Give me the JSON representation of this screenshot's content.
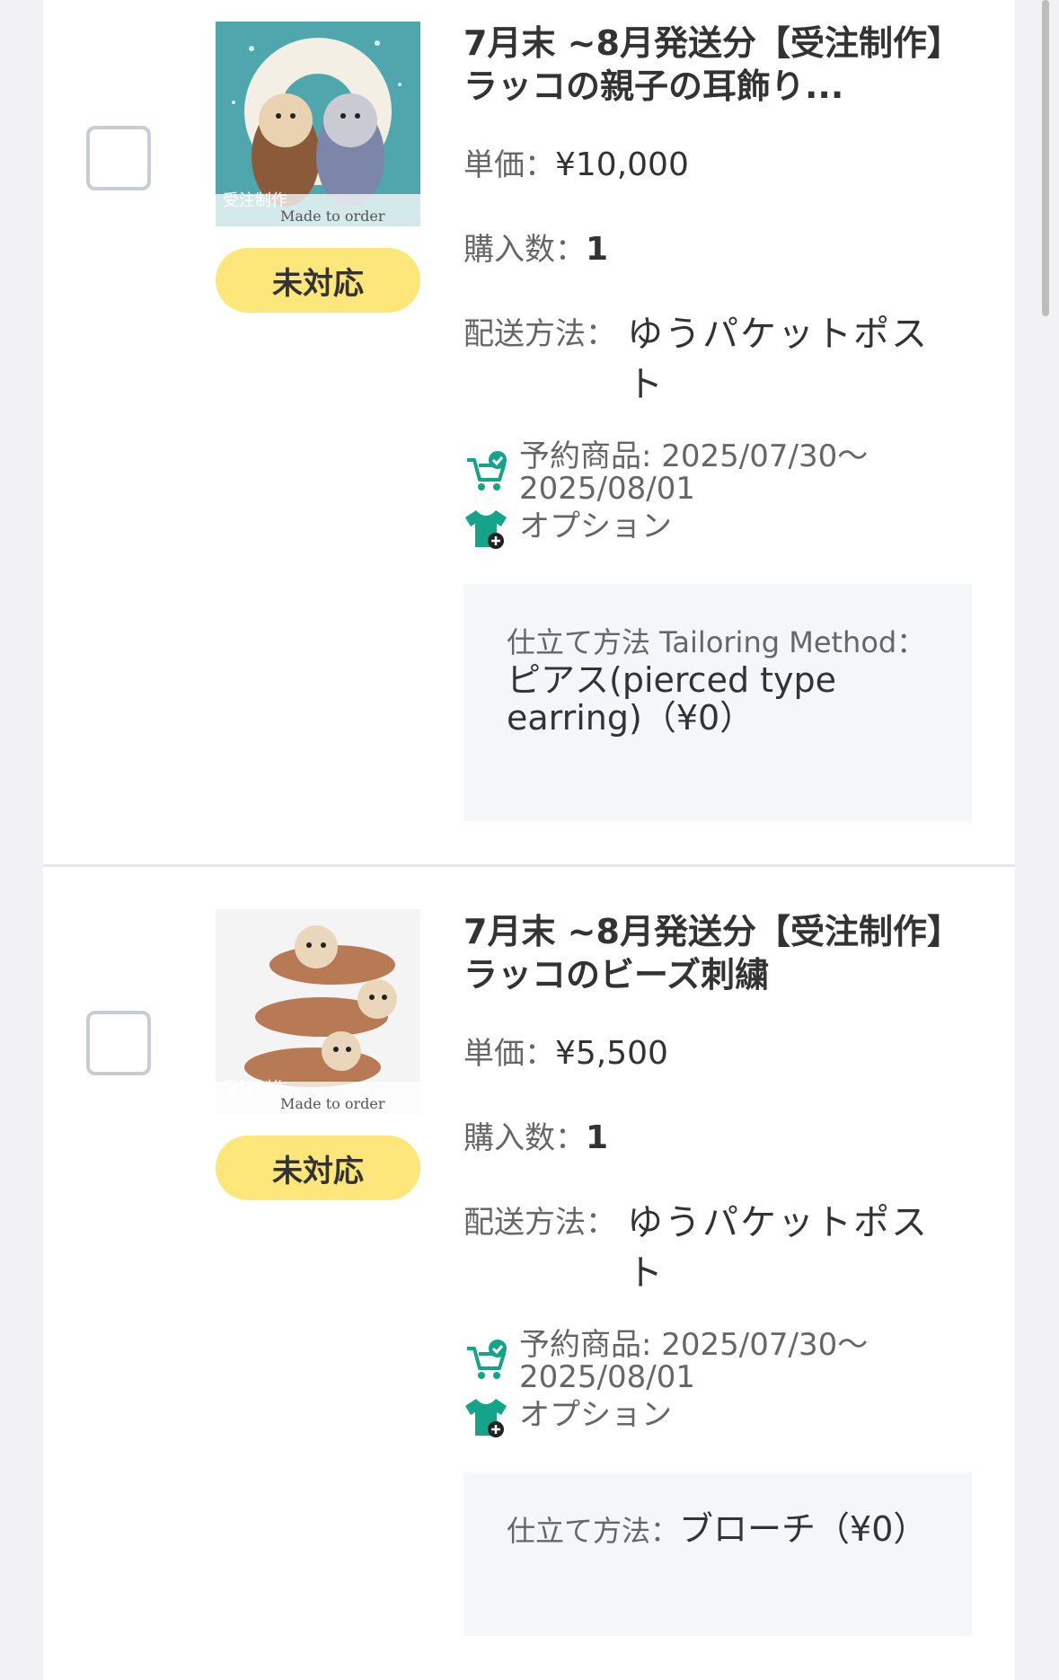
{
  "orders": [
    {
      "title": "7月末 ~8月発送分【受注制作】ラッコの親子の耳飾り...",
      "status": "未対応",
      "unit_price_label": "単価：",
      "unit_price": "¥10,000",
      "quantity_label": "購入数：",
      "quantity": "1",
      "shipping_label": "配送方法：",
      "shipping": "ゆうパケットポスト",
      "reservation": "予約商品: 2025/07/30〜2025/08/01",
      "option_label": "オプション",
      "option_key": "仕立て方法 Tailoring Method：",
      "option_value": "ピアス(pierced type earring)（¥0）",
      "thumb_caption": "受注制作",
      "thumb_caption2": "Made to order"
    },
    {
      "title": "7月末 ~8月発送分【受注制作】ラッコのビーズ刺繍",
      "status": "未対応",
      "unit_price_label": "単価：",
      "unit_price": "¥5,500",
      "quantity_label": "購入数：",
      "quantity": "1",
      "shipping_label": "配送方法：",
      "shipping": "ゆうパケットポスト",
      "reservation": "予約商品: 2025/07/30〜2025/08/01",
      "option_label": "オプション",
      "option_key": "仕立て方法：",
      "option_value": "ブローチ（¥0）",
      "thumb_caption": "受注制作",
      "thumb_caption2": "Made to order"
    }
  ],
  "icons": {
    "reservation": "cart-check-icon",
    "option": "shirt-plus-icon"
  },
  "colors": {
    "badge": "#fde77a",
    "icon_teal": "#15a38a",
    "option_bg": "#f5f6f8"
  }
}
